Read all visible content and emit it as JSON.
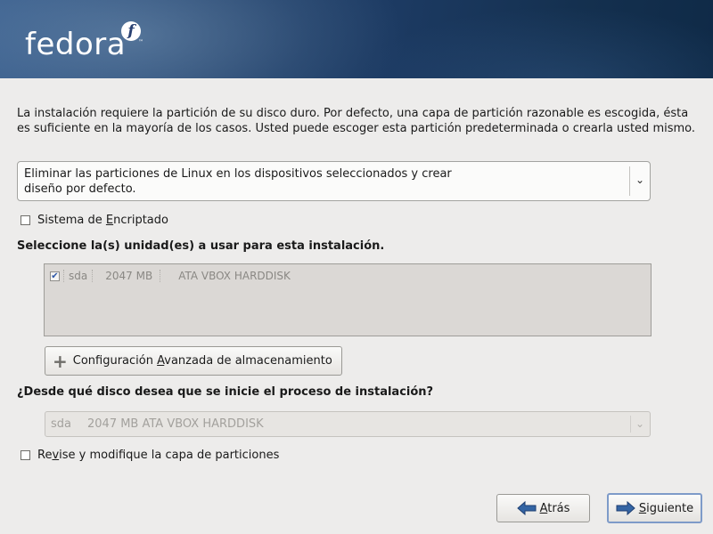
{
  "header": {
    "logo_text": "fedora",
    "logo_mark": "f",
    "trademark": "™"
  },
  "intro_text": "La instalación requiere la partición de su disco duro. Por defecto, una capa de partición razonable es escogida, ésta es suficiente en la mayoría de los casos. Usted puede escoger esta partición predeterminada o crearla usted mismo.",
  "partition_combo": {
    "selected": "Eliminar las particiones de Linux en los dispositivos seleccionados y crear diseño por defecto.",
    "arrow_icon": "chevron-down-icon"
  },
  "encrypt": {
    "label_before": "Sistema de ",
    "label_mnemonic": "E",
    "label_after": "ncriptado",
    "checked": false
  },
  "drives_title": "Seleccione la(s) unidad(es) a usar para esta instalación.",
  "drives": [
    {
      "checked": true,
      "name": "sda",
      "size": "2047 MB",
      "model": "ATA VBOX HARDDISK"
    }
  ],
  "advanced_button": {
    "label_before": "Configuración ",
    "label_mnemonic": "A",
    "label_after": "vanzada de almacenamiento",
    "icon": "plus-icon"
  },
  "boot_title": "¿Desde qué disco desea que se inicie el proceso de instalación?",
  "boot_combo": {
    "name": "sda",
    "detail": "2047 MB ATA VBOX HARDDISK",
    "enabled": false
  },
  "review": {
    "label_before": "Re",
    "label_mnemonic": "v",
    "label_after": "ise y modifique la capa de particiones",
    "checked": false
  },
  "nav": {
    "back_before": "",
    "back_mnemonic": "A",
    "back_after": "trás",
    "next_before": "",
    "next_mnemonic": "S",
    "next_after": "iguiente",
    "arrow_color": "#3465a4"
  }
}
